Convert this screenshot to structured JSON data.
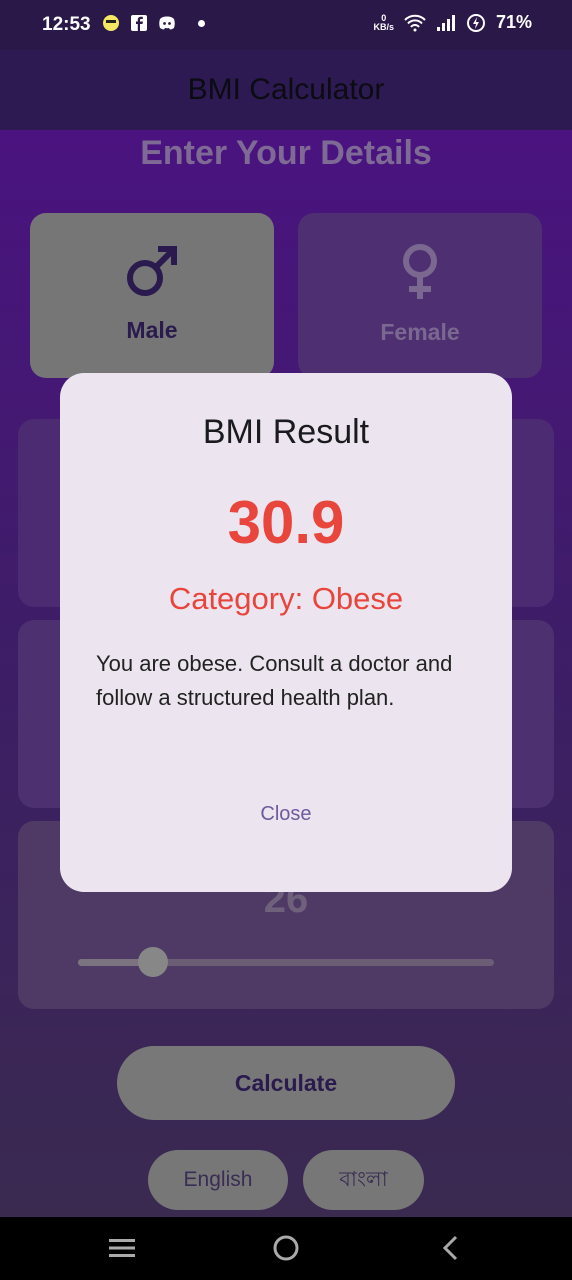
{
  "status_bar": {
    "time": "12:53",
    "net_speed_value": "0",
    "net_speed_unit": "KB/s",
    "battery": "71%"
  },
  "app_bar": {
    "title": "BMI Calculator"
  },
  "main": {
    "heading": "Enter Your Details",
    "gender": {
      "male_label": "Male",
      "female_label": "Female",
      "selected": "Male"
    },
    "age_value": "26",
    "slider_fraction": 0.18,
    "calculate_label": "Calculate",
    "languages": {
      "english": "English",
      "bangla": "বাংলা"
    }
  },
  "dialog": {
    "title": "BMI Result",
    "value": "30.9",
    "category": "Category: Obese",
    "message": "You are obese. Consult a doctor and follow a structured health plan.",
    "close_label": "Close",
    "accent_color": "#e8453c"
  },
  "icons": {
    "status_left": [
      "emoji-icon",
      "facebook-icon",
      "discord-icon"
    ],
    "status_right": [
      "wifi-icon",
      "signal-icon",
      "battery-charging-icon"
    ],
    "nav": [
      "menu-icon",
      "home-icon",
      "back-icon"
    ]
  }
}
